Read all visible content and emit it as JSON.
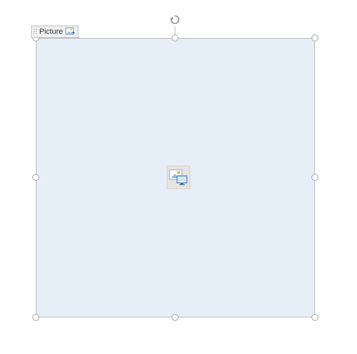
{
  "placeholder": {
    "tag_label": "Picture",
    "tag_icon": "picture-content-control-icon",
    "center_icon": "image-placeholder-icon",
    "fill_color": "#e6eef8",
    "border_color": "#b9b9b9"
  },
  "selection": {
    "handles": [
      "top-left",
      "top-middle",
      "top-right",
      "middle-left",
      "middle-right",
      "bottom-left",
      "bottom-middle",
      "bottom-right"
    ],
    "rotation_handle": true
  }
}
